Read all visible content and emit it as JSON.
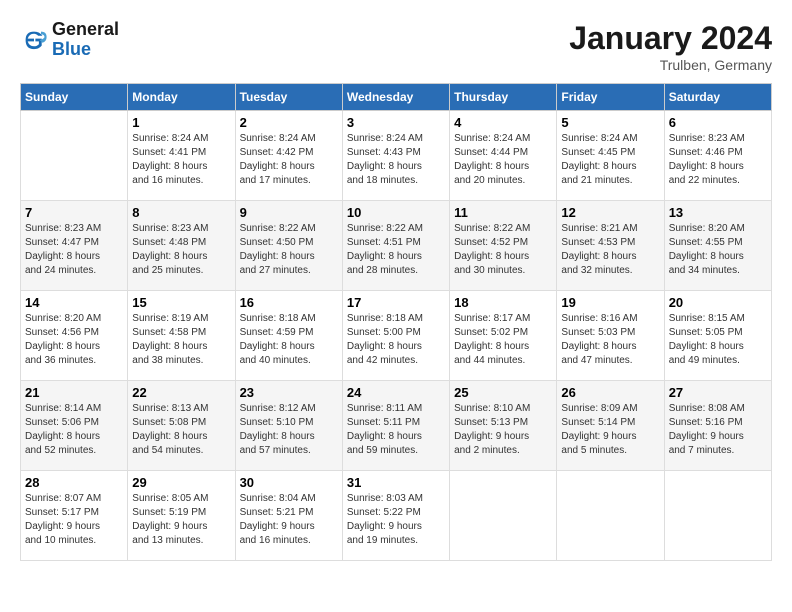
{
  "logo": {
    "line1": "General",
    "line2": "Blue"
  },
  "title": "January 2024",
  "subtitle": "Trulben, Germany",
  "days_of_week": [
    "Sunday",
    "Monday",
    "Tuesday",
    "Wednesday",
    "Thursday",
    "Friday",
    "Saturday"
  ],
  "weeks": [
    [
      {
        "day": "",
        "info": ""
      },
      {
        "day": "1",
        "info": "Sunrise: 8:24 AM\nSunset: 4:41 PM\nDaylight: 8 hours\nand 16 minutes."
      },
      {
        "day": "2",
        "info": "Sunrise: 8:24 AM\nSunset: 4:42 PM\nDaylight: 8 hours\nand 17 minutes."
      },
      {
        "day": "3",
        "info": "Sunrise: 8:24 AM\nSunset: 4:43 PM\nDaylight: 8 hours\nand 18 minutes."
      },
      {
        "day": "4",
        "info": "Sunrise: 8:24 AM\nSunset: 4:44 PM\nDaylight: 8 hours\nand 20 minutes."
      },
      {
        "day": "5",
        "info": "Sunrise: 8:24 AM\nSunset: 4:45 PM\nDaylight: 8 hours\nand 21 minutes."
      },
      {
        "day": "6",
        "info": "Sunrise: 8:23 AM\nSunset: 4:46 PM\nDaylight: 8 hours\nand 22 minutes."
      }
    ],
    [
      {
        "day": "7",
        "info": "Sunrise: 8:23 AM\nSunset: 4:47 PM\nDaylight: 8 hours\nand 24 minutes."
      },
      {
        "day": "8",
        "info": "Sunrise: 8:23 AM\nSunset: 4:48 PM\nDaylight: 8 hours\nand 25 minutes."
      },
      {
        "day": "9",
        "info": "Sunrise: 8:22 AM\nSunset: 4:50 PM\nDaylight: 8 hours\nand 27 minutes."
      },
      {
        "day": "10",
        "info": "Sunrise: 8:22 AM\nSunset: 4:51 PM\nDaylight: 8 hours\nand 28 minutes."
      },
      {
        "day": "11",
        "info": "Sunrise: 8:22 AM\nSunset: 4:52 PM\nDaylight: 8 hours\nand 30 minutes."
      },
      {
        "day": "12",
        "info": "Sunrise: 8:21 AM\nSunset: 4:53 PM\nDaylight: 8 hours\nand 32 minutes."
      },
      {
        "day": "13",
        "info": "Sunrise: 8:20 AM\nSunset: 4:55 PM\nDaylight: 8 hours\nand 34 minutes."
      }
    ],
    [
      {
        "day": "14",
        "info": "Sunrise: 8:20 AM\nSunset: 4:56 PM\nDaylight: 8 hours\nand 36 minutes."
      },
      {
        "day": "15",
        "info": "Sunrise: 8:19 AM\nSunset: 4:58 PM\nDaylight: 8 hours\nand 38 minutes."
      },
      {
        "day": "16",
        "info": "Sunrise: 8:18 AM\nSunset: 4:59 PM\nDaylight: 8 hours\nand 40 minutes."
      },
      {
        "day": "17",
        "info": "Sunrise: 8:18 AM\nSunset: 5:00 PM\nDaylight: 8 hours\nand 42 minutes."
      },
      {
        "day": "18",
        "info": "Sunrise: 8:17 AM\nSunset: 5:02 PM\nDaylight: 8 hours\nand 44 minutes."
      },
      {
        "day": "19",
        "info": "Sunrise: 8:16 AM\nSunset: 5:03 PM\nDaylight: 8 hours\nand 47 minutes."
      },
      {
        "day": "20",
        "info": "Sunrise: 8:15 AM\nSunset: 5:05 PM\nDaylight: 8 hours\nand 49 minutes."
      }
    ],
    [
      {
        "day": "21",
        "info": "Sunrise: 8:14 AM\nSunset: 5:06 PM\nDaylight: 8 hours\nand 52 minutes."
      },
      {
        "day": "22",
        "info": "Sunrise: 8:13 AM\nSunset: 5:08 PM\nDaylight: 8 hours\nand 54 minutes."
      },
      {
        "day": "23",
        "info": "Sunrise: 8:12 AM\nSunset: 5:10 PM\nDaylight: 8 hours\nand 57 minutes."
      },
      {
        "day": "24",
        "info": "Sunrise: 8:11 AM\nSunset: 5:11 PM\nDaylight: 8 hours\nand 59 minutes."
      },
      {
        "day": "25",
        "info": "Sunrise: 8:10 AM\nSunset: 5:13 PM\nDaylight: 9 hours\nand 2 minutes."
      },
      {
        "day": "26",
        "info": "Sunrise: 8:09 AM\nSunset: 5:14 PM\nDaylight: 9 hours\nand 5 minutes."
      },
      {
        "day": "27",
        "info": "Sunrise: 8:08 AM\nSunset: 5:16 PM\nDaylight: 9 hours\nand 7 minutes."
      }
    ],
    [
      {
        "day": "28",
        "info": "Sunrise: 8:07 AM\nSunset: 5:17 PM\nDaylight: 9 hours\nand 10 minutes."
      },
      {
        "day": "29",
        "info": "Sunrise: 8:05 AM\nSunset: 5:19 PM\nDaylight: 9 hours\nand 13 minutes."
      },
      {
        "day": "30",
        "info": "Sunrise: 8:04 AM\nSunset: 5:21 PM\nDaylight: 9 hours\nand 16 minutes."
      },
      {
        "day": "31",
        "info": "Sunrise: 8:03 AM\nSunset: 5:22 PM\nDaylight: 9 hours\nand 19 minutes."
      },
      {
        "day": "",
        "info": ""
      },
      {
        "day": "",
        "info": ""
      },
      {
        "day": "",
        "info": ""
      }
    ]
  ]
}
